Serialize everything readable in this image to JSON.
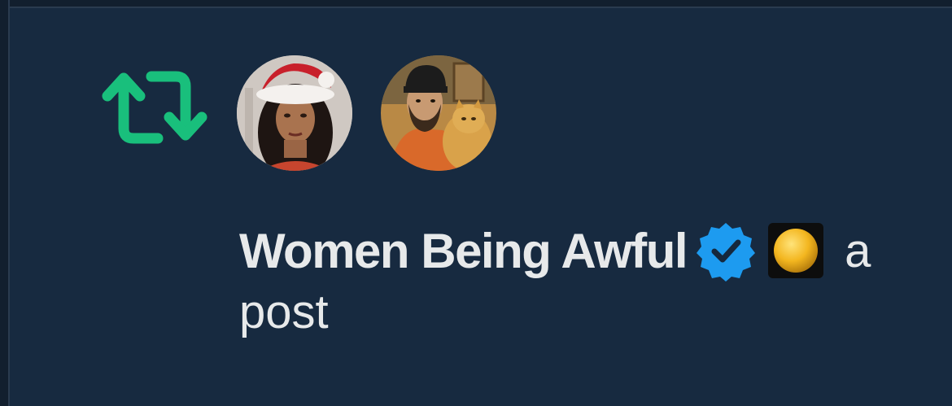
{
  "notification": {
    "account_name": "Women Being Awful",
    "action_text_visible": "a",
    "line2": "post",
    "icon": "retweet-icon",
    "badges": [
      "verified-badge-icon",
      "affiliate-badge-icon"
    ],
    "avatars": [
      "avatar-santa-hat",
      "avatar-bearded-man-cat"
    ]
  },
  "colors": {
    "background": "#172a40",
    "retweet_green": "#19bf7c",
    "verified_blue": "#1d9bf0",
    "text": "#e7e9ea"
  }
}
